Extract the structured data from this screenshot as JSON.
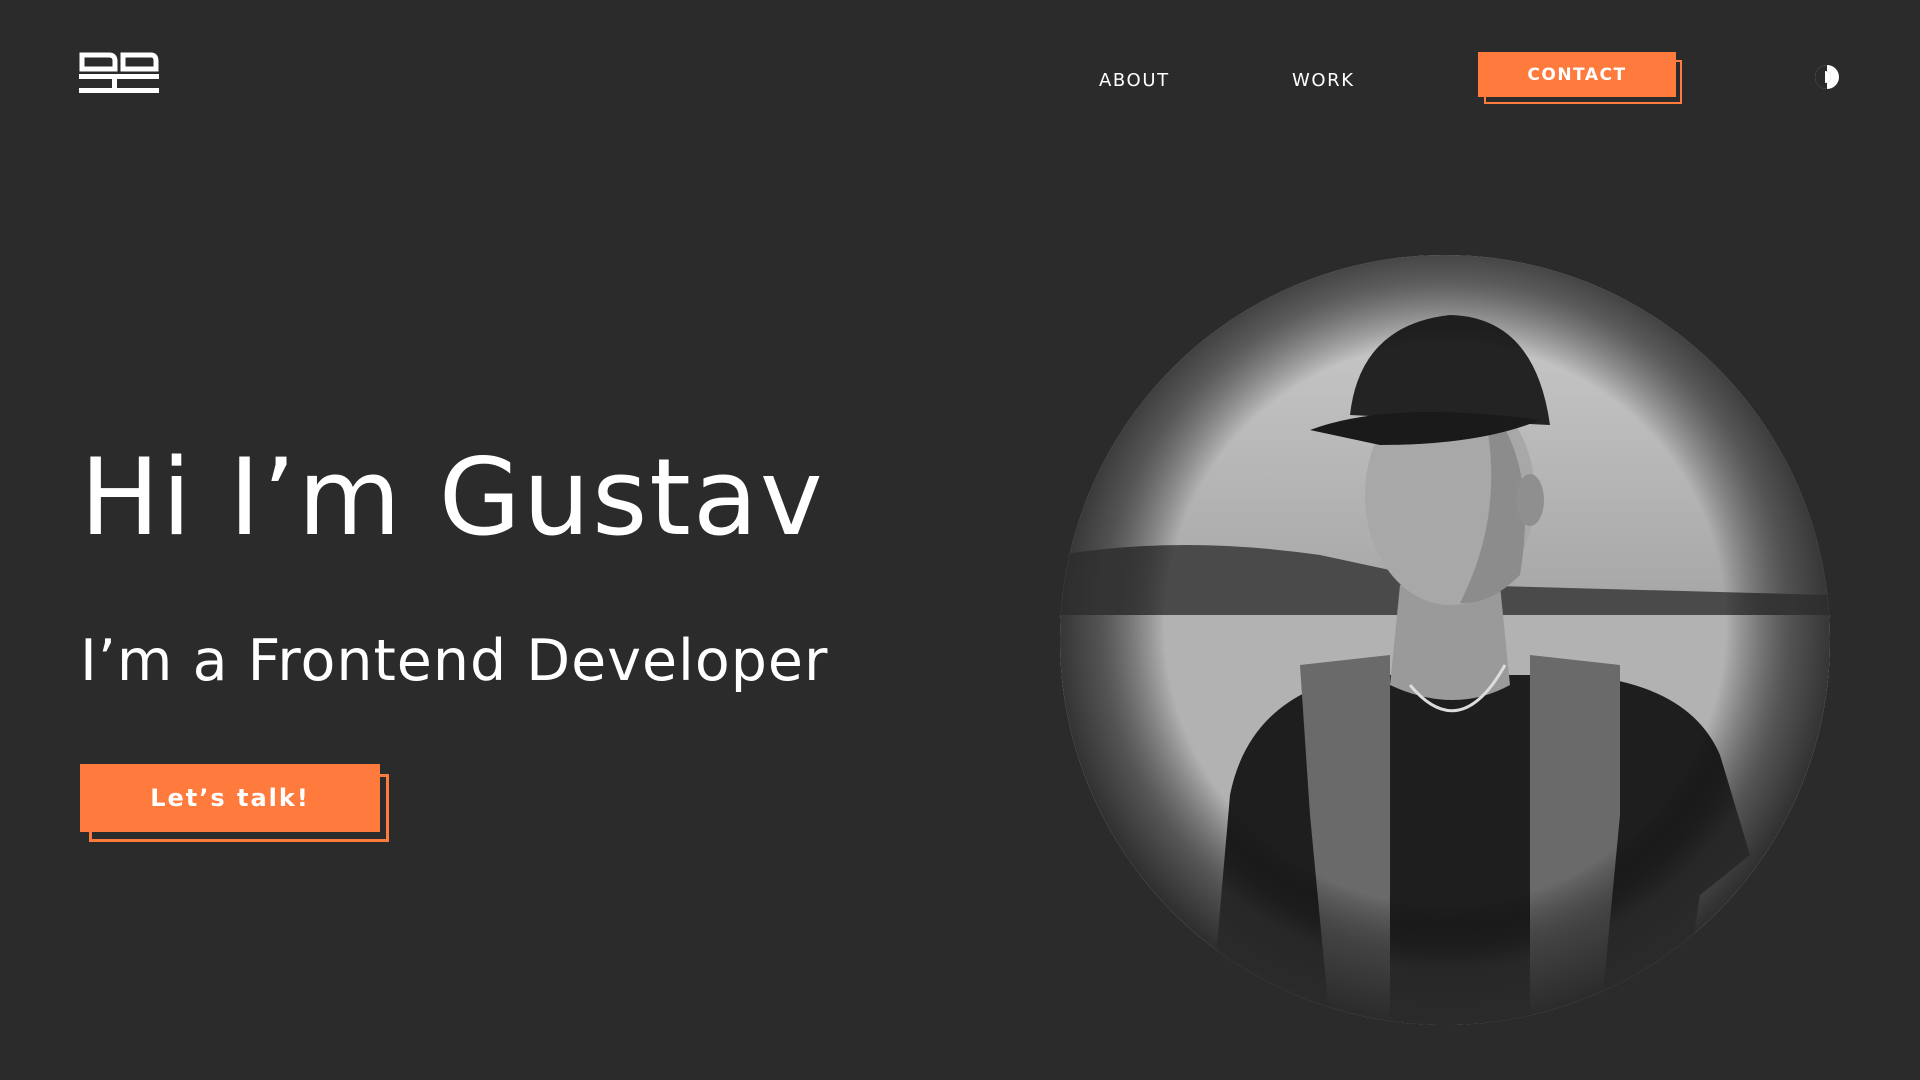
{
  "header": {
    "logo_icon": "monogram-logo-icon",
    "nav": [
      {
        "label": "ABOUT"
      },
      {
        "label": "WORK"
      }
    ],
    "contact_label": "CONTACT",
    "theme_toggle_icon": "theme-toggle-icon"
  },
  "hero": {
    "title": "Hi I’m Gustav",
    "subtitle": "I’m a Frontend Developer",
    "cta_label": "Let’s talk!",
    "portrait_icon": "portrait-photo"
  },
  "colors": {
    "background": "#2b2b2b",
    "accent": "#ff7a3d",
    "text": "#ffffff"
  }
}
